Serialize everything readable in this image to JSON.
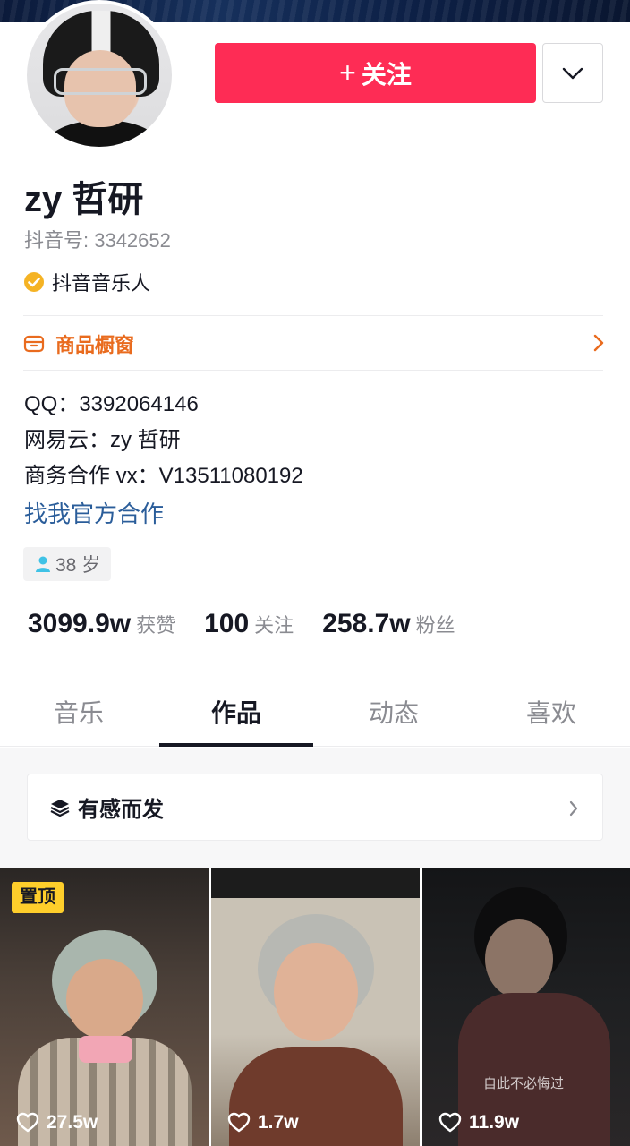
{
  "profile": {
    "name": "zy 哲研",
    "douyin_id": "抖音号: 3342652",
    "badge": "抖音音乐人",
    "follow_label": "关注"
  },
  "shop": {
    "label": "商品橱窗"
  },
  "bio": {
    "lines": [
      "QQ：3392064146",
      "网易云：zy 哲研",
      "商务合作 vx：V13511080192"
    ],
    "link": "找我官方合作"
  },
  "age_tag": "38 岁",
  "stats": [
    {
      "value": "3099.9w",
      "label": "获赞"
    },
    {
      "value": "100",
      "label": "关注"
    },
    {
      "value": "258.7w",
      "label": "粉丝"
    }
  ],
  "tabs": [
    {
      "label": "音乐",
      "active": false
    },
    {
      "label": "作品",
      "active": true
    },
    {
      "label": "动态",
      "active": false
    },
    {
      "label": "喜欢",
      "active": false
    }
  ],
  "collection": {
    "label": "有感而发"
  },
  "videos": [
    {
      "likes": "27.5w",
      "pinned_label": "置顶"
    },
    {
      "likes": "1.7w"
    },
    {
      "likes": "11.9w",
      "caption": "自此不必悔过"
    }
  ],
  "colors": {
    "accent": "#fe2c55",
    "shop": "#e96b1e",
    "link": "#2a5d9a",
    "pin": "#fece2b"
  }
}
